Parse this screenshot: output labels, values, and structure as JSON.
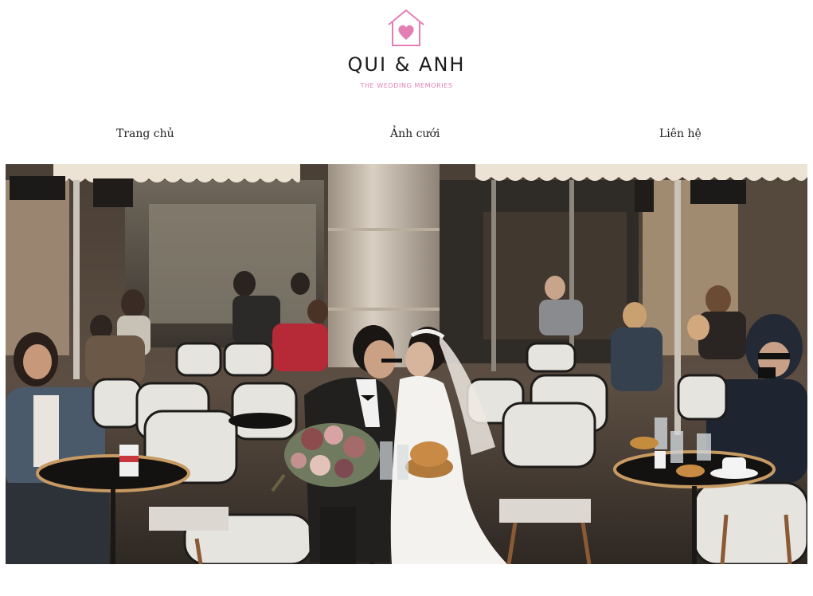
{
  "header": {
    "brand_title": "QUI & ANH",
    "brand_subtitle": "THE WEDDING MEMORIES",
    "brand_icon": "heart-house-icon",
    "accent_color": "#e37fb5"
  },
  "nav": {
    "items": [
      {
        "label": "Trang chủ"
      },
      {
        "label": "Ảnh cưới"
      },
      {
        "label": "Liên hệ"
      }
    ]
  },
  "hero": {
    "subject": "wedding-photo-cafe"
  }
}
